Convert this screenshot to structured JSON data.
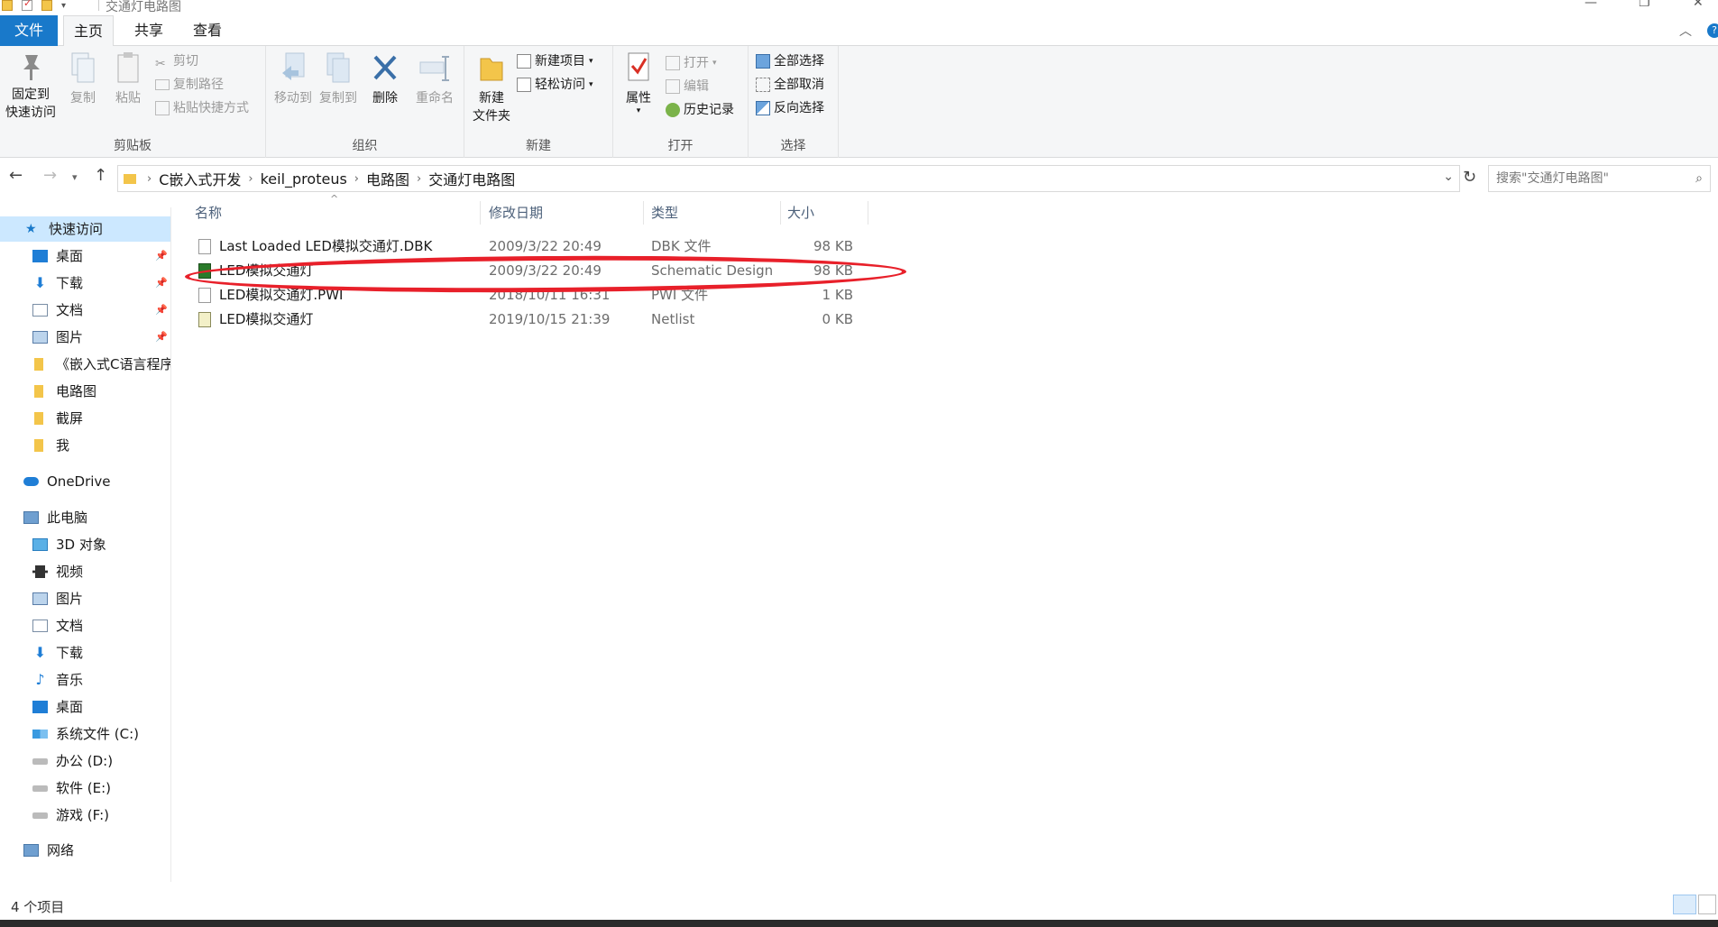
{
  "window": {
    "title": "交通灯电路图"
  },
  "ribbon_tabs": [
    {
      "label": "文件"
    },
    {
      "label": "主页"
    },
    {
      "label": "共享"
    },
    {
      "label": "查看"
    }
  ],
  "ribbon": {
    "clipboard": {
      "pin_label_1": "固定到",
      "pin_label_2": "快速访问",
      "copy": "复制",
      "paste": "粘贴",
      "cut": "剪切",
      "copy_path": "复制路径",
      "paste_shortcut": "粘贴快捷方式",
      "group": "剪贴板"
    },
    "organize": {
      "move_to": "移动到",
      "copy_to": "复制到",
      "delete": "删除",
      "rename": "重命名",
      "group": "组织"
    },
    "new": {
      "new_folder_1": "新建",
      "new_folder_2": "文件夹",
      "new_item": "新建项目",
      "easy_access": "轻松访问",
      "group": "新建"
    },
    "open": {
      "properties": "属性",
      "open": "打开",
      "edit": "编辑",
      "history": "历史记录",
      "group": "打开"
    },
    "select": {
      "select_all": "全部选择",
      "select_none": "全部取消",
      "invert": "反向选择",
      "group": "选择"
    }
  },
  "address": {
    "crumbs": [
      "C嵌入式开发",
      "keil_proteus",
      "电路图",
      "交通灯电路图"
    ],
    "search_placeholder": "搜索\"交通灯电路图\""
  },
  "sidebar": {
    "quick_access": "快速访问",
    "items": [
      {
        "label": "桌面",
        "pinned": true
      },
      {
        "label": "下载",
        "pinned": true
      },
      {
        "label": "文档",
        "pinned": true
      },
      {
        "label": "图片",
        "pinned": true
      },
      {
        "label": "《嵌入式C语言程序"
      },
      {
        "label": "电路图"
      },
      {
        "label": "截屏"
      },
      {
        "label": "我"
      }
    ],
    "onedrive": "OneDrive",
    "this_pc": "此电脑",
    "pc_items": [
      {
        "label": "3D 对象"
      },
      {
        "label": "视频"
      },
      {
        "label": "图片"
      },
      {
        "label": "文档"
      },
      {
        "label": "下载"
      },
      {
        "label": "音乐"
      },
      {
        "label": "桌面"
      },
      {
        "label": "系统文件 (C:)"
      },
      {
        "label": "办公 (D:)"
      },
      {
        "label": "软件 (E:)"
      },
      {
        "label": "游戏 (F:)"
      }
    ],
    "network": "网络"
  },
  "columns": {
    "name": "名称",
    "date": "修改日期",
    "type": "类型",
    "size": "大小"
  },
  "files": [
    {
      "name": "Last Loaded LED模拟交通灯.DBK",
      "date": "2009/3/22 20:49",
      "type": "DBK 文件",
      "size": "98 KB",
      "icon": "document-icon"
    },
    {
      "name": "LED模拟交通灯",
      "date": "2009/3/22 20:49",
      "type": "Schematic Design",
      "size": "98 KB",
      "icon": "proteus-design-icon"
    },
    {
      "name": "LED模拟交通灯.PWI",
      "date": "2018/10/11 16:31",
      "type": "PWI 文件",
      "size": "1 KB",
      "icon": "document-icon"
    },
    {
      "name": "LED模拟交通灯",
      "date": "2019/10/15 21:39",
      "type": "Netlist",
      "size": "0 KB",
      "icon": "netlist-icon"
    }
  ],
  "status": {
    "count": "4 个项目"
  },
  "colors": {
    "accent": "#1979ca",
    "selection": "#cce8ff",
    "annotation": "#e8202a"
  }
}
